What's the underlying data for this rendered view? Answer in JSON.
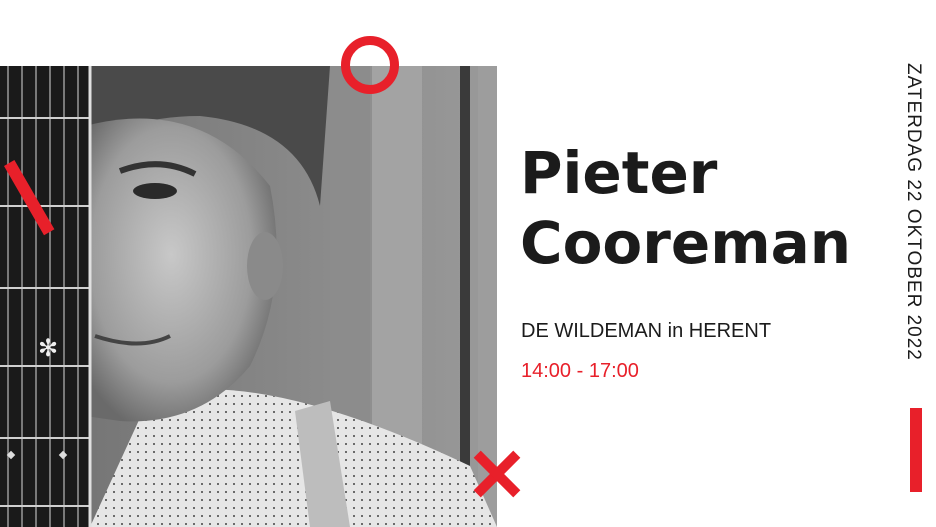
{
  "event": {
    "title_line1": "Pieter",
    "title_line2": "Cooreman",
    "venue": "DE WILDEMAN in HERENT",
    "time": "14:00 - 17:00",
    "date": "ZATERDAG 22 OKTOBER 2022"
  },
  "colors": {
    "accent": "#e8202a",
    "text": "#1b1b1b",
    "background": "#ffffff"
  },
  "decorations": [
    "red-circle",
    "red-slash",
    "red-x",
    "red-bar"
  ],
  "photo": {
    "subject": "guitarist-portrait",
    "style": "black-and-white"
  }
}
